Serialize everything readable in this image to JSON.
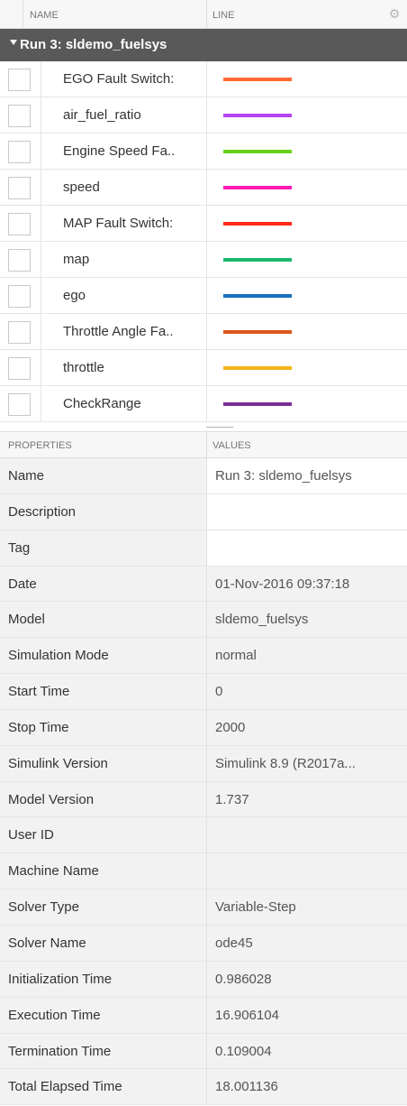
{
  "signals_table": {
    "header": {
      "name_label": "NAME",
      "line_label": "LINE",
      "settings_icon": "gear-icon"
    },
    "run": {
      "label": "Run 3: sldemo_fuelsys",
      "expanded_icon": "caret-down-icon"
    },
    "signals": [
      {
        "name": "EGO Fault Switch:",
        "line_color": "#ff6a33",
        "checked": false
      },
      {
        "name": "air_fuel_ratio",
        "line_color": "#b344f0",
        "checked": false
      },
      {
        "name": "Engine Speed Fa..",
        "line_color": "#66d11a",
        "checked": false
      },
      {
        "name": "speed",
        "line_color": "#ff1ab3",
        "checked": false
      },
      {
        "name": "MAP Fault Switch:",
        "line_color": "#ff2a1a",
        "checked": false
      },
      {
        "name": "map",
        "line_color": "#1ab86b",
        "checked": false
      },
      {
        "name": "ego",
        "line_color": "#1a6fbf",
        "checked": false
      },
      {
        "name": "Throttle Angle Fa..",
        "line_color": "#d95719",
        "checked": false
      },
      {
        "name": "throttle",
        "line_color": "#f2b51a",
        "checked": false
      },
      {
        "name": "CheckRange",
        "line_color": "#7a2e96",
        "checked": false
      }
    ]
  },
  "properties_table": {
    "header": {
      "properties_label": "PROPERTIES",
      "values_label": "VALUES"
    },
    "rows": [
      {
        "key": "Name",
        "value": "Run 3: sldemo_fuelsys",
        "editable": true
      },
      {
        "key": "Description",
        "value": "",
        "editable": true
      },
      {
        "key": "Tag",
        "value": "",
        "editable": true
      },
      {
        "key": "Date",
        "value": "01-Nov-2016 09:37:18",
        "editable": false
      },
      {
        "key": "Model",
        "value": "sldemo_fuelsys",
        "editable": false
      },
      {
        "key": "Simulation Mode",
        "value": "normal",
        "editable": false
      },
      {
        "key": "Start Time",
        "value": "0",
        "editable": false
      },
      {
        "key": "Stop Time",
        "value": "2000",
        "editable": false
      },
      {
        "key": "Simulink Version",
        "value": "Simulink 8.9 (R2017a...",
        "editable": false
      },
      {
        "key": "Model Version",
        "value": "1.737",
        "editable": false
      },
      {
        "key": "User ID",
        "value": "",
        "editable": false
      },
      {
        "key": "Machine Name",
        "value": "",
        "editable": false
      },
      {
        "key": "Solver Type",
        "value": "Variable-Step",
        "editable": false
      },
      {
        "key": "Solver Name",
        "value": "ode45",
        "editable": false
      },
      {
        "key": "Initialization Time",
        "value": "0.986028",
        "editable": false
      },
      {
        "key": "Execution Time",
        "value": "16.906104",
        "editable": false
      },
      {
        "key": "Termination Time",
        "value": "0.109004",
        "editable": false
      },
      {
        "key": "Total Elapsed Time",
        "value": "18.001136",
        "editable": false
      }
    ]
  }
}
